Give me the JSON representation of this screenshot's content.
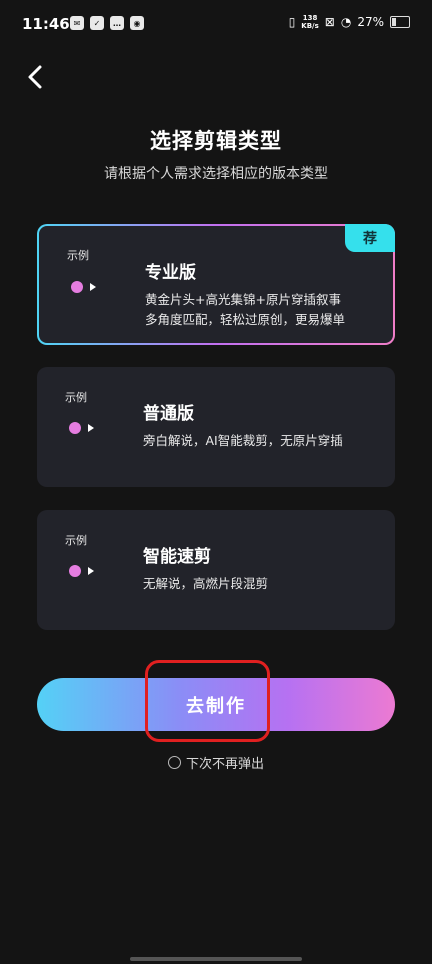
{
  "status_bar": {
    "time": "11:46",
    "left_icons": [
      "mail-icon",
      "check-icon",
      "chat-icon",
      "wechat-icon"
    ],
    "net_speed": "138",
    "net_unit": "KB/s",
    "battery": "27%"
  },
  "header": {
    "title": "选择剪辑类型",
    "subtitle": "请根据个人需求选择相应的版本类型"
  },
  "options": [
    {
      "example_label": "示例",
      "title": "专业版",
      "desc_line1": "黄金片头+高光集锦+原片穿插叙事",
      "desc_line2": "多角度匹配，轻松过原创，更易爆单",
      "badge": "荐",
      "selected": true
    },
    {
      "example_label": "示例",
      "title": "普通版",
      "desc_line1": "旁白解说，AI智能裁剪，无原片穿插",
      "desc_line2": "",
      "selected": false
    },
    {
      "example_label": "示例",
      "title": "智能速剪",
      "desc_line1": "无解说，高燃片段混剪",
      "desc_line2": "",
      "selected": false
    }
  ],
  "action": {
    "label": "去制作"
  },
  "dont_show": {
    "label": "下次不再弹出"
  },
  "colors": {
    "accent_cyan": "#35e0ec",
    "gradient_start": "#54d1f6",
    "gradient_end": "#ec7ad2",
    "highlight_red": "#e02020"
  }
}
